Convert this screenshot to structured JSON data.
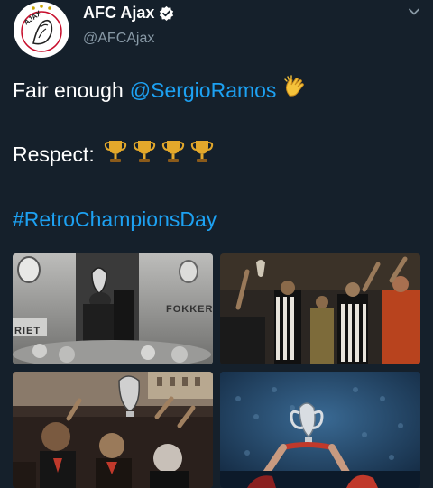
{
  "account": {
    "name": "AFC Ajax",
    "handle": "@AFCAjax",
    "logo_text": "AJAX"
  },
  "tweet": {
    "line1_text": "Fair enough",
    "mention": "@SergioRamos",
    "line1_emoji": "clapping-hands",
    "line2_text": "Respect:",
    "trophy_count": 4,
    "hashtag": "#RetroChampionsDay"
  },
  "media": {
    "tiles": [
      {
        "description": "fokker-airplane-trophy",
        "label_1": "FOKKER",
        "label_2": "RIET"
      },
      {
        "description": "stadium-celebration"
      },
      {
        "description": "street-parade-trophy"
      },
      {
        "description": "trophy-raised-crowd"
      }
    ]
  },
  "colors": {
    "background": "#15202b",
    "link": "#1da1f2",
    "secondary_text": "#8899a6",
    "verified": "#ffffff"
  }
}
